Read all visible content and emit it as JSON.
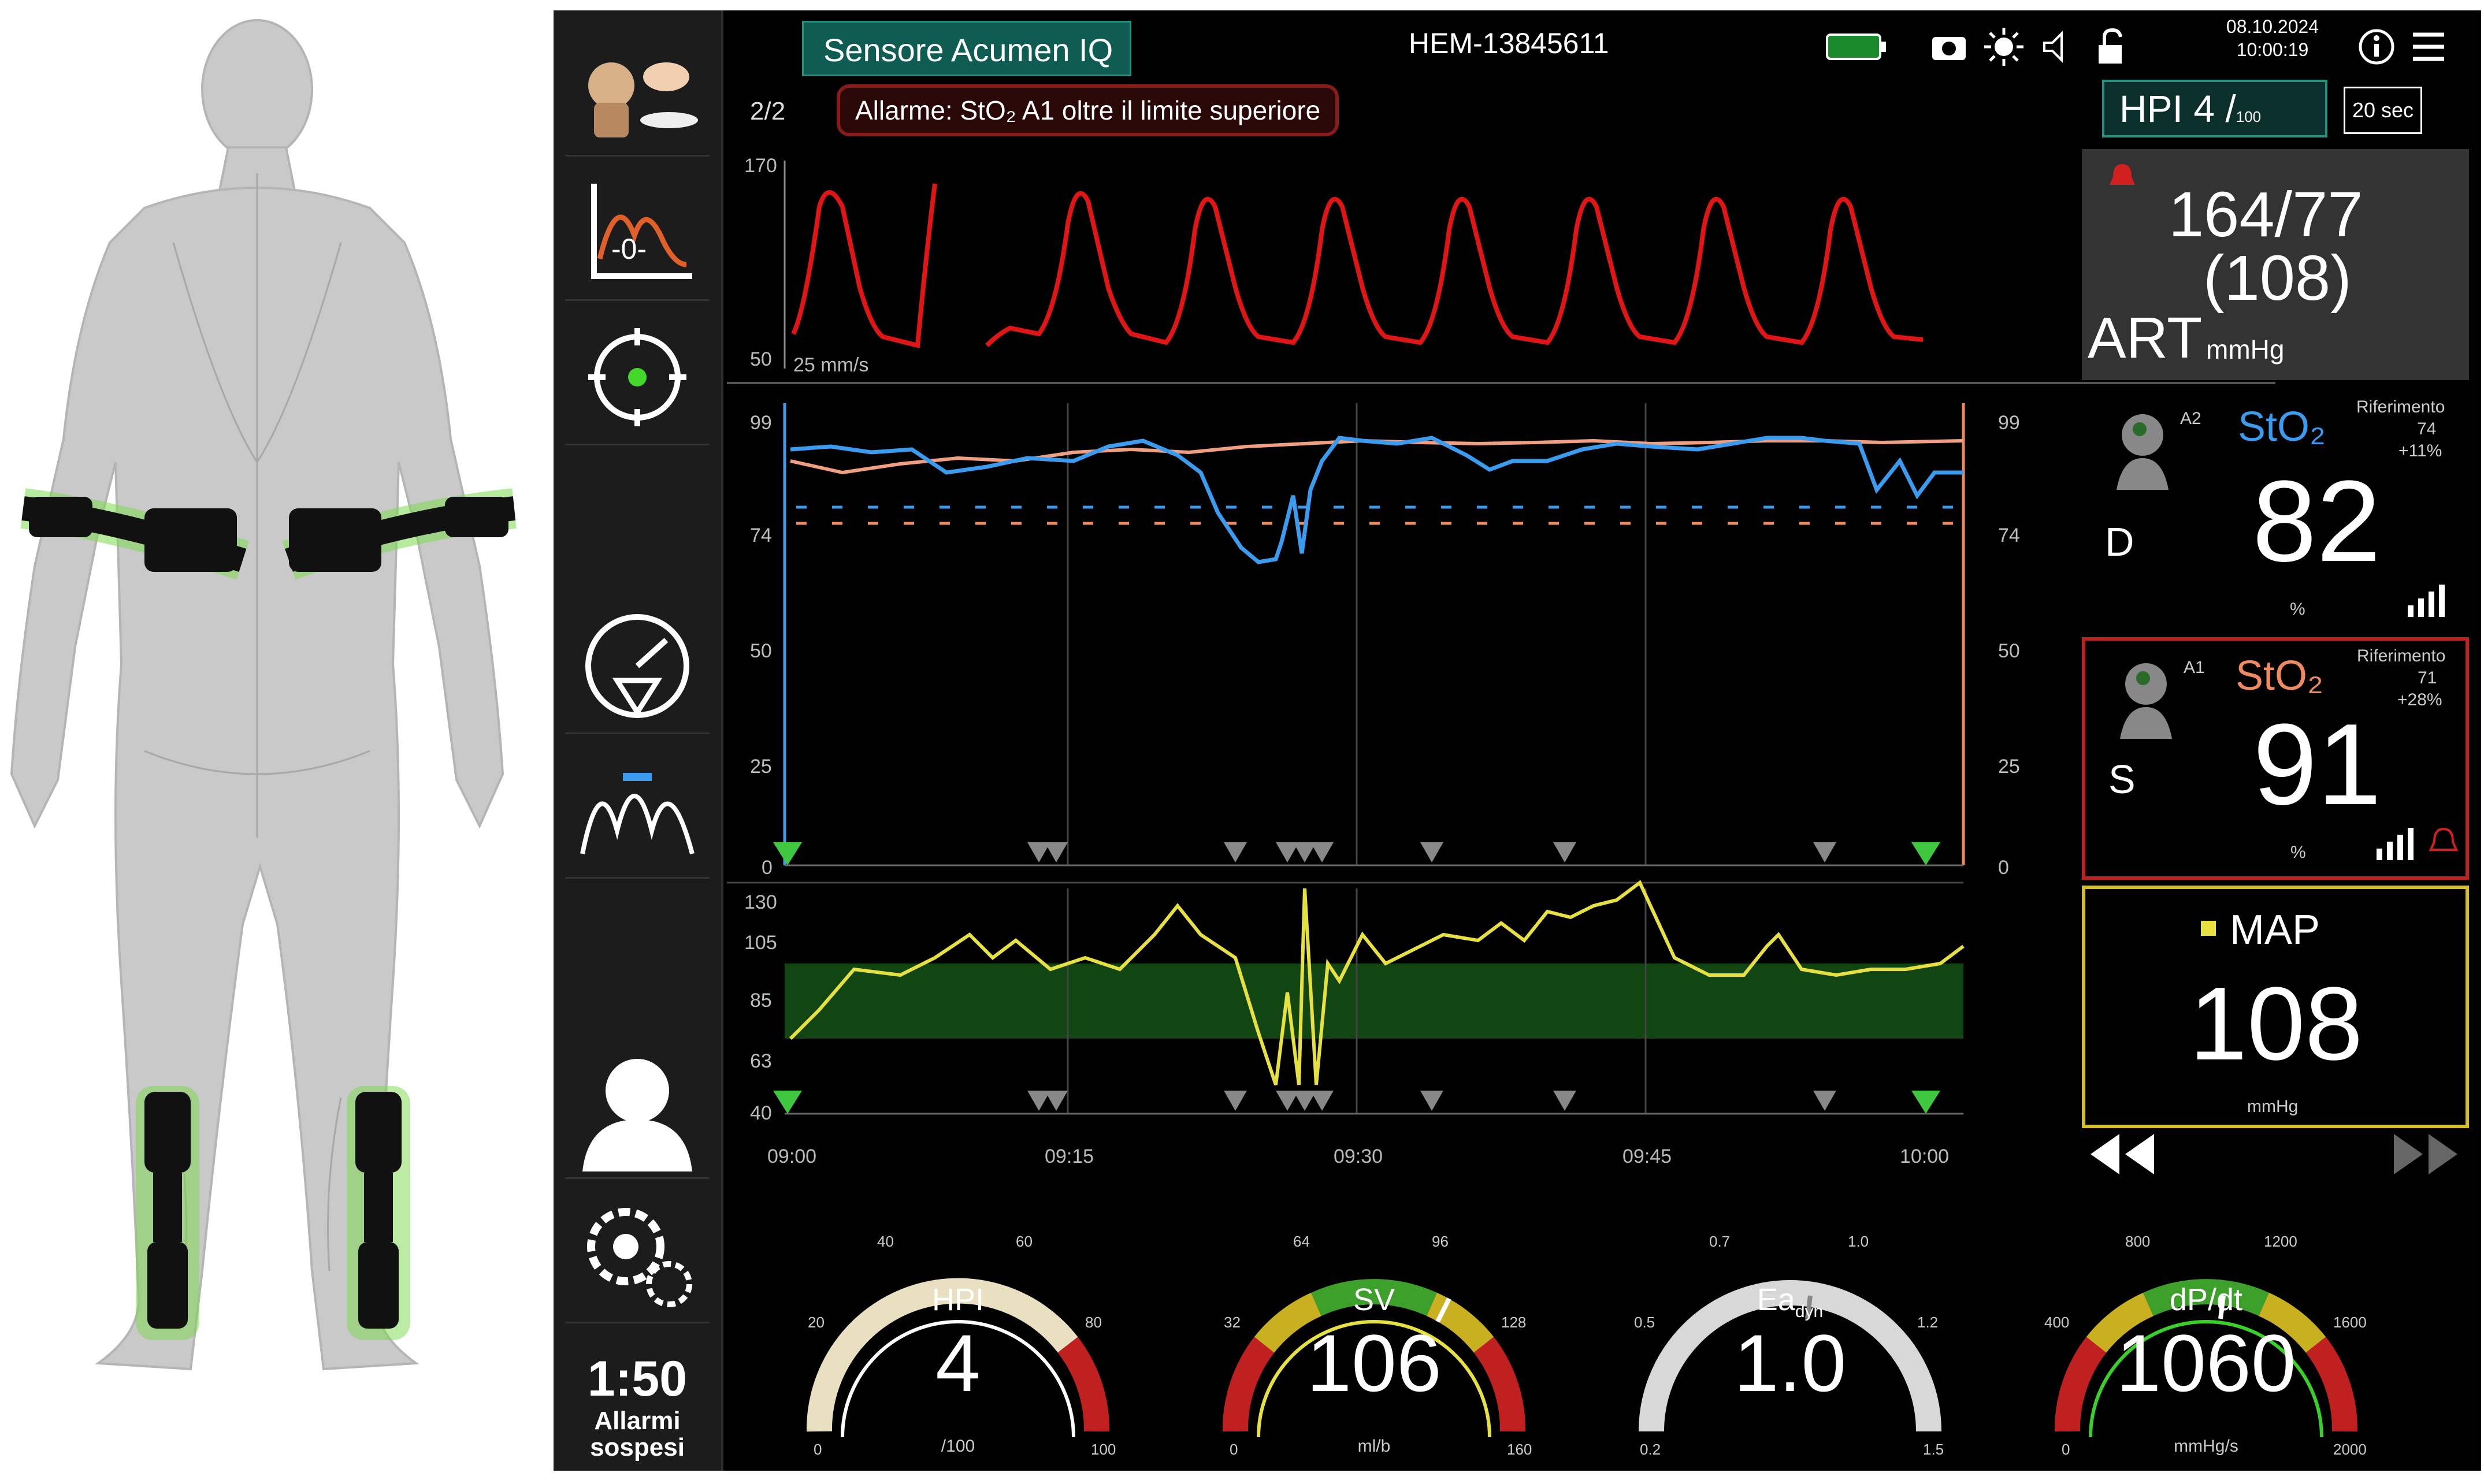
{
  "monitor": {
    "sensor_tab": "Sensore Acumen IQ",
    "device_id": "HEM-13845611",
    "page_indicator": "2/2",
    "alarm_banner": "Allarme: StO₂ A1 oltre il limite superiore",
    "date": "08.10.2024",
    "time": "10:00:19",
    "hpi_tab": "HPI 4 /",
    "hpi_tab_unit": "100",
    "interval": "20 sec"
  },
  "sidebar": {
    "timer_value": "1:50",
    "timer_label1": "Allarmi",
    "timer_label2": "sospesi",
    "icons": [
      "sensor-config-icon",
      "trend-graph-icon",
      "target-icon",
      "gauge-icon",
      "waveform-icon",
      "patient-icon",
      "settings-gears-icon"
    ]
  },
  "art_chart": {
    "y_top": "170",
    "y_bottom": "50",
    "speed": "25 mm/s"
  },
  "sto2_chart": {
    "y_left": [
      "99",
      "74",
      "50",
      "25",
      "0"
    ],
    "y_right": [
      "99",
      "74",
      "50",
      "25",
      "0"
    ]
  },
  "map_chart": {
    "y_left": [
      "130",
      "105",
      "85",
      "63",
      "40"
    ]
  },
  "time_axis": [
    "09:00",
    "09:15",
    "09:30",
    "09:45",
    "10:00"
  ],
  "art_tile": {
    "systolic_diastolic": "164/77",
    "mean": "(108)",
    "label": "ART",
    "unit": "mmHg"
  },
  "sto2_d": {
    "channel": "A2",
    "name": "StO₂",
    "side": "D",
    "value": "82",
    "unit": "%",
    "ref_label": "Riferimento",
    "ref_value": "74",
    "ref_delta": "+11%",
    "color": "#3a9bef"
  },
  "sto2_s": {
    "channel": "A1",
    "name": "StO₂",
    "side": "S",
    "value": "91",
    "unit": "%",
    "ref_label": "Riferimento",
    "ref_value": "71",
    "ref_delta": "+28%",
    "color": "#f08a60"
  },
  "map_tile": {
    "name": "MAP",
    "value": "108",
    "unit": "mmHg"
  },
  "gauges": [
    {
      "name": "HPI",
      "value": "4",
      "unit": "/100",
      "min": "0",
      "max": "100",
      "ticks": [
        "20",
        "40",
        "60",
        "80"
      ]
    },
    {
      "name": "SV",
      "value": "106",
      "unit": "ml/b",
      "min": "0",
      "max": "160",
      "ticks": [
        "32",
        "64",
        "96",
        "128"
      ]
    },
    {
      "name": "Ea",
      "name_sub": "dyn",
      "value": "1.0",
      "unit": "",
      "min": "0.2",
      "max": "1.5",
      "ticks": [
        "0.5",
        "0.7",
        "1.0",
        "1.2"
      ]
    },
    {
      "name": "dP/dt",
      "value": "1060",
      "unit": "mmHg/s",
      "min": "0",
      "max": "2000",
      "ticks": [
        "400",
        "800",
        "1200",
        "1600"
      ]
    }
  ]
}
